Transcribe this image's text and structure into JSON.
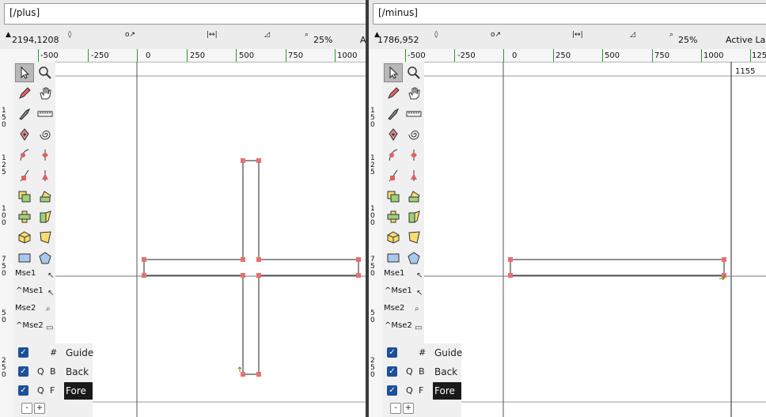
{
  "left": {
    "name": "[/plus]",
    "coords": "2194,1208",
    "zoom": "25%",
    "active_layer_partial": "A",
    "ruler": [
      "-500",
      "-250",
      "0",
      "250",
      "500",
      "750",
      "1000"
    ],
    "vruler": [
      "1\n5\n0",
      "1\n2\n5",
      "1\n0\n0",
      "7\n5\n0",
      "5\n0",
      "2\n5\n0"
    ],
    "mouse": [
      "Mse1",
      "^Mse1",
      "Mse2",
      "^Mse2"
    ],
    "layers": [
      {
        "c1": "#",
        "c2": "",
        "name": "Guide"
      },
      {
        "c1": "Q",
        "c2": "B",
        "name": "Back"
      },
      {
        "c1": "Q",
        "c2": "F",
        "name": "Fore"
      }
    ]
  },
  "right": {
    "name": "[/minus]",
    "coords": "1786,952",
    "zoom": "25%",
    "active_layer": "Active Lay",
    "ruler": [
      "-500",
      "-250",
      "0",
      "250",
      "500",
      "750",
      "1000",
      "125"
    ],
    "vruler": [
      "1\n5\n0",
      "1\n2\n5",
      "1\n0\n0",
      "7\n5\n0",
      "5\n0",
      "2\n5\n0"
    ],
    "guide_value": "1155",
    "mouse": [
      "Mse1",
      "^Mse1",
      "Mse2",
      "^Mse2"
    ],
    "layers": [
      {
        "c1": "#",
        "c2": "",
        "name": "Guide"
      },
      {
        "c1": "Q",
        "c2": "B",
        "name": "Back"
      },
      {
        "c1": "Q",
        "c2": "F",
        "name": "Fore"
      }
    ]
  },
  "layer_buttons": [
    "-",
    "+"
  ],
  "colors": {
    "ruler_tick": "#2a9a2a",
    "point": "#e06060",
    "active_layer_bg": "#1a1a1a",
    "checkbox": "#1e4f9a"
  },
  "icons": {
    "select": "arrow-pointer",
    "magnify": "magnifier",
    "pencil": "pencil",
    "hand": "hand",
    "knife": "knife",
    "ruler": "ruler",
    "pen": "pen-nib",
    "spiral": "spiral"
  }
}
